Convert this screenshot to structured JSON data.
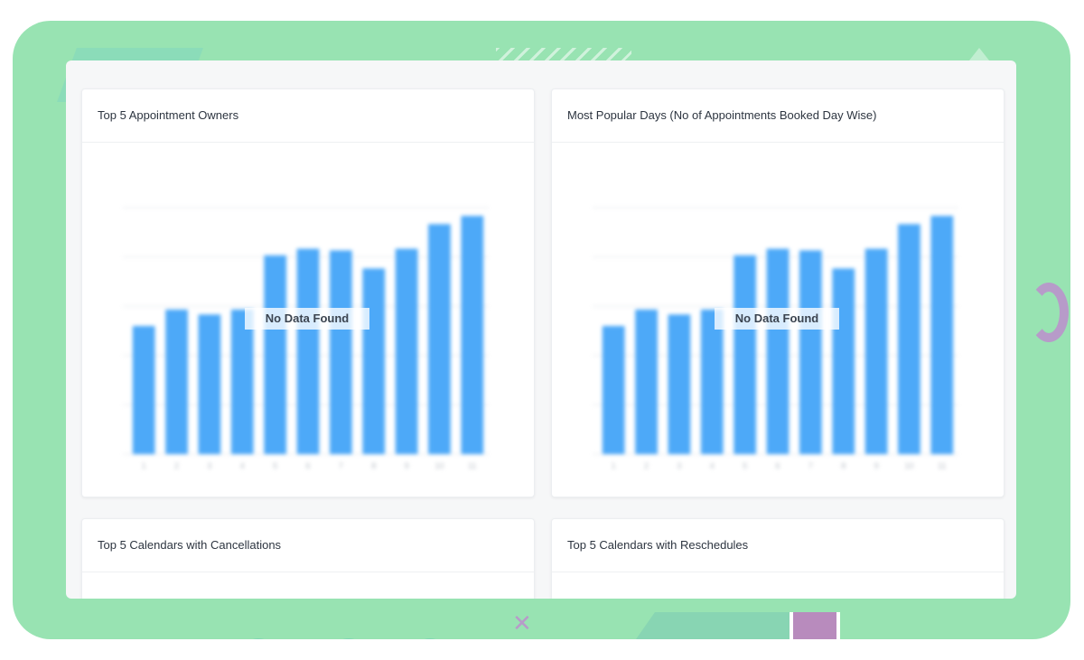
{
  "colors": {
    "frame": "#98e3b2",
    "bar": "#4da9f8",
    "panel": "#f6f7f8"
  },
  "cards": [
    {
      "title": "Top 5 Appointment Owners",
      "empty_message": "No Data Found"
    },
    {
      "title": "Most Popular Days (No of Appointments Booked Day Wise)",
      "empty_message": "No Data Found"
    },
    {
      "title": "Top 5 Calendars with Cancellations"
    },
    {
      "title": "Top 5 Calendars with Reschedules"
    }
  ],
  "chart_data": [
    {
      "type": "bar",
      "categories": [
        "1",
        "2",
        "3",
        "4",
        "5",
        "6",
        "7",
        "8",
        "9",
        "10",
        "11"
      ],
      "values": [
        78,
        88,
        85,
        88,
        121,
        125,
        124,
        113,
        125,
        140,
        145
      ],
      "ylim": [
        0,
        150
      ],
      "grid": true
    },
    {
      "type": "bar",
      "categories": [
        "1",
        "2",
        "3",
        "4",
        "5",
        "6",
        "7",
        "8",
        "9",
        "10",
        "11"
      ],
      "values": [
        78,
        88,
        85,
        88,
        121,
        125,
        124,
        113,
        125,
        140,
        145
      ],
      "ylim": [
        0,
        150
      ],
      "grid": true
    }
  ]
}
